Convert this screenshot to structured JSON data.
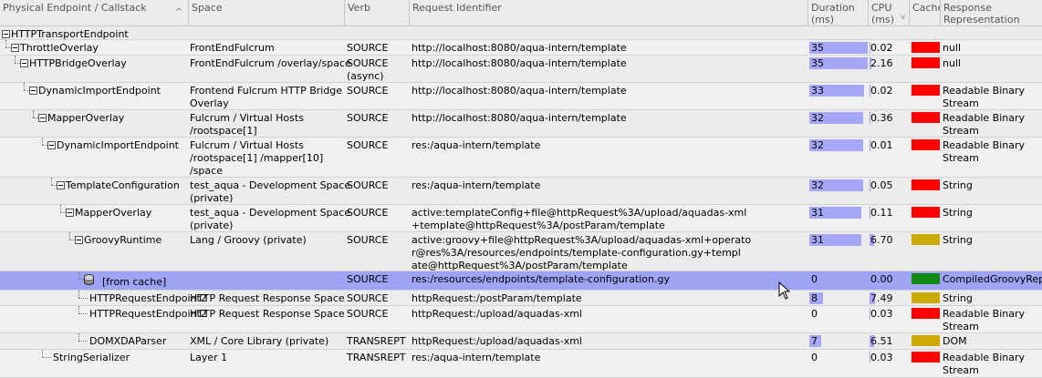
{
  "columns": {
    "callstack": "Physical Endpoint / Callstack",
    "space": "Space",
    "verb": "Verb",
    "request": "Request Identifier",
    "duration_l1": "Duration",
    "duration_l2": "(ms)",
    "cpu_l1": "CPU",
    "cpu_l2": "(ms)",
    "cache": "Cache",
    "response_l1": "Response",
    "response_l2": "Representation",
    "sort_indicator": "^",
    "dropdown_indicator": "v"
  },
  "colors": {
    "red": "#ff0000",
    "yellow": "#ccaa00",
    "green": "#118811",
    "bar": "#a7a7f7",
    "selected": "#9ea3f4"
  },
  "rows": [
    {
      "name": "HTTPTransportEndpoint",
      "space": "",
      "verb": "",
      "request": "",
      "duration": "",
      "cpu": "",
      "dur_val": 0,
      "cpu_val": 0,
      "cache": "",
      "response": ""
    },
    {
      "name": "ThrottleOverlay",
      "space": "FrontEndFulcrum",
      "verb": "SOURCE",
      "request": "http://localhost:8080/aqua-intern/template",
      "duration": "35",
      "cpu": "0.02",
      "dur_val": 35,
      "cpu_val": 0.02,
      "cache": "red",
      "response": "null"
    },
    {
      "name": "HTTPBridgeOverlay",
      "space": "FrontEndFulcrum /overlay/space",
      "verb": "SOURCE\n(async)",
      "request": "http://localhost:8080/aqua-intern/template",
      "duration": "35",
      "cpu": "2.16",
      "dur_val": 35,
      "cpu_val": 2.16,
      "cache": "red",
      "response": "null"
    },
    {
      "name": "DynamicImportEndpoint",
      "space": "Frontend Fulcrum HTTP Bridge\nOverlay",
      "verb": "SOURCE",
      "request": "http://localhost:8080/aqua-intern/template",
      "duration": "33",
      "cpu": "0.02",
      "dur_val": 33,
      "cpu_val": 0.02,
      "cache": "red",
      "response": "Readable Binary\nStream"
    },
    {
      "name": "MapperOverlay",
      "space": "Fulcrum / Virtual Hosts\n/rootspace[1]",
      "verb": "SOURCE",
      "request": "http://localhost:8080/aqua-intern/template",
      "duration": "32",
      "cpu": "0.36",
      "dur_val": 32,
      "cpu_val": 0.36,
      "cache": "red",
      "response": "Readable Binary\nStream"
    },
    {
      "name": "DynamicImportEndpoint",
      "space": "Fulcrum / Virtual Hosts\n/rootspace[1] /mapper[10]\n/space",
      "verb": "SOURCE",
      "request": "res:/aqua-intern/template",
      "duration": "32",
      "cpu": "0.01",
      "dur_val": 32,
      "cpu_val": 0.01,
      "cache": "red",
      "response": "Readable Binary\nStream"
    },
    {
      "name": "TemplateConfiguration",
      "space": "test_aqua - Development Space\n(private)",
      "verb": "SOURCE",
      "request": "res:/aqua-intern/template",
      "duration": "32",
      "cpu": "0.05",
      "dur_val": 32,
      "cpu_val": 0.05,
      "cache": "red",
      "response": "String"
    },
    {
      "name": "MapperOverlay",
      "space": "test_aqua - Development Space\n(private)",
      "verb": "SOURCE",
      "request": "active:templateConfig+file@httpRequest%3A/upload/aquadas-xml\n+template@httpRequest%3A/postParam/template",
      "duration": "31",
      "cpu": "0.11",
      "dur_val": 31,
      "cpu_val": 0.11,
      "cache": "red",
      "response": "String"
    },
    {
      "name": "GroovyRuntime",
      "space": "Lang / Groovy (private)",
      "verb": "SOURCE",
      "request": "active:groovy+file@httpRequest%3A/upload/aquadas-xml+operato\nr@res%3A/resources/endpoints/template-configuration.gy+templ\nate@httpRequest%3A/postParam/template",
      "duration": "31",
      "cpu": "6.70",
      "dur_val": 31,
      "cpu_val": 6.7,
      "cache": "yellow",
      "response": "String"
    },
    {
      "name": "[from cache]",
      "space": "",
      "verb": "SOURCE",
      "request": "res:/resources/endpoints/template-configuration.gy",
      "duration": "0",
      "cpu": "0.00",
      "dur_val": 0,
      "cpu_val": 0,
      "cache": "green",
      "response": "CompiledGroovyRep"
    },
    {
      "name": "HTTPRequestEndpoint2",
      "space": "HTTP Request Response Space",
      "verb": "SOURCE",
      "request": "httpRequest:/postParam/template",
      "duration": "8",
      "cpu": "7.49",
      "dur_val": 8,
      "cpu_val": 7.49,
      "cache": "yellow",
      "response": "String"
    },
    {
      "name": "HTTPRequestEndpoint2",
      "space": "HTTP Request Response Space",
      "verb": "SOURCE",
      "request": "httpRequest:/upload/aquadas-xml",
      "duration": "0",
      "cpu": "0.03",
      "dur_val": 0,
      "cpu_val": 0.03,
      "cache": "red",
      "response": "Readable Binary\nStream"
    },
    {
      "name": "DOMXDAParser",
      "space": "XML / Core Library (private)",
      "verb": "TRANSREPT",
      "request": "httpRequest:/upload/aquadas-xml",
      "duration": "7",
      "cpu": "6.51",
      "dur_val": 7,
      "cpu_val": 6.51,
      "cache": "yellow",
      "response": "DOM"
    },
    {
      "name": "StringSerializer",
      "space": "Layer 1",
      "verb": "TRANSREPT",
      "request": "res:/aqua-intern/template",
      "duration": "0",
      "cpu": "0.03",
      "dur_val": 0,
      "cpu_val": 0.03,
      "cache": "red",
      "response": "Readable Binary\nStream"
    }
  ]
}
